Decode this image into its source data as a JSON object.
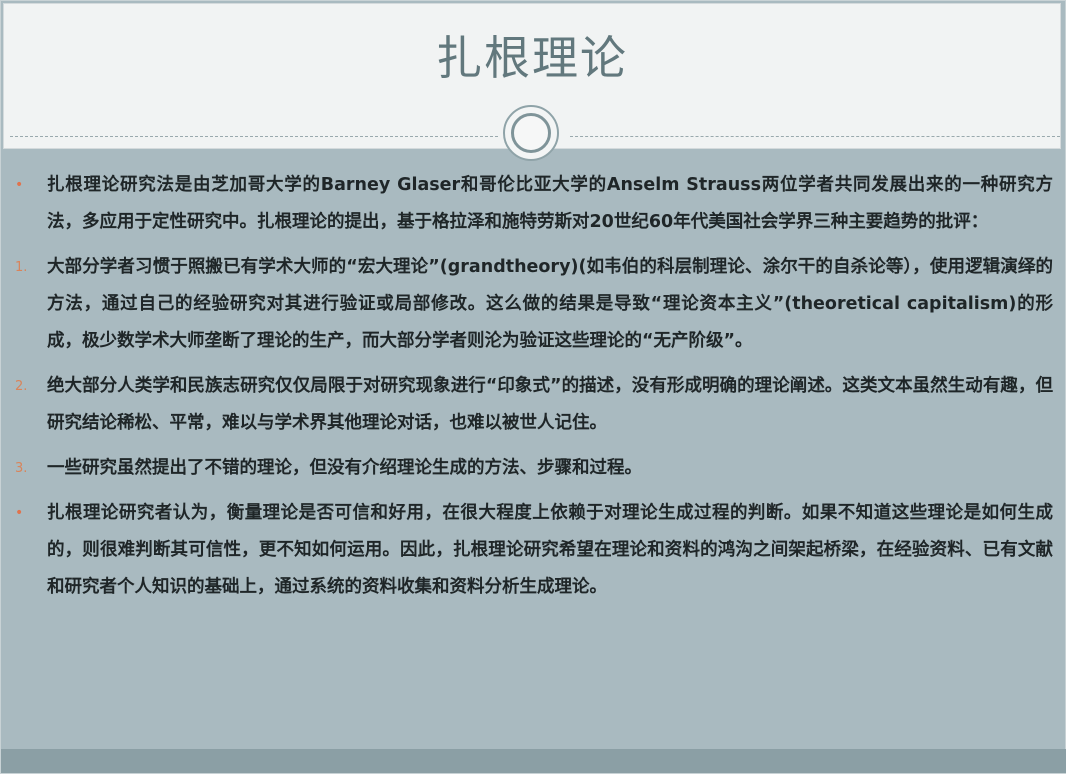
{
  "slide": {
    "title": "扎根理论",
    "items": [
      {
        "marker": "•",
        "text": "扎根理论研究法是由芝加哥大学的Barney Glaser和哥伦比亚大学的Anselm Strauss两位学者共同发展出来的一种研究方法，多应用于定性研究中。扎根理论的提出，基于格拉泽和施特劳斯对20世纪60年代美国社会学界三种主要趋势的批评："
      },
      {
        "marker": "1.",
        "text": "大部分学者习惯于照搬已有学术大师的“宏大理论”(grandtheory)(如韦伯的科层制理论、涂尔干的自杀论等），使用逻辑演绎的方法，通过自己的经验研究对其进行验证或局部修改。这么做的结果是导致“理论资本主义”(theoretical capitalism)的形成，极少数学术大师垄断了理论的生产，而大部分学者则沦为验证这些理论的“无产阶级”。"
      },
      {
        "marker": "2.",
        "text": "绝大部分人类学和民族志研究仅仅局限于对研究现象进行“印象式”的描述，没有形成明确的理论阐述。这类文本虽然生动有趣，但研究结论稀松、平常，难以与学术界其他理论对话，也难以被世人记住。"
      },
      {
        "marker": "3.",
        "text": "一些研究虽然提出了不错的理论，但没有介绍理论生成的方法、步骤和过程。"
      },
      {
        "marker": "•",
        "text": "扎根理论研究者认为，衡量理论是否可信和好用，在很大程度上依赖于对理论生成过程的判断。如果不知道这些理论是如何生成的，则很难判断其可信性，更不知如何运用。因此，扎根理论研究希望在理论和资料的鸿沟之间架起桥梁，在经验资料、已有文献和研究者个人知识的基础上，通过系统的资料收集和资料分析生成理论。"
      }
    ]
  },
  "colors": {
    "title": "#62787d",
    "body_bg": "#a9bac0",
    "header_bg": "#f1f3f3",
    "marker": "#e0734d"
  }
}
